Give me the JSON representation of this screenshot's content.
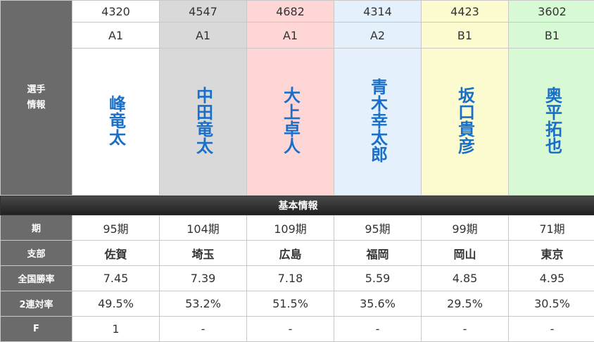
{
  "racers": [
    {
      "number": "4320",
      "class": "A1",
      "name": "峰竜太",
      "term": "95期",
      "branch": "佐賀",
      "win_rate": "7.45",
      "quinella_rate": "49.5%",
      "f": "1"
    },
    {
      "number": "4547",
      "class": "A1",
      "name": "中田竜太",
      "term": "104期",
      "branch": "埼玉",
      "win_rate": "7.39",
      "quinella_rate": "53.2%",
      "f": "-"
    },
    {
      "number": "4682",
      "class": "A1",
      "name": "大上卓人",
      "term": "109期",
      "branch": "広島",
      "win_rate": "7.18",
      "quinella_rate": "51.5%",
      "f": "-"
    },
    {
      "number": "4314",
      "class": "A2",
      "name": "青木幸太郎",
      "term": "95期",
      "branch": "福岡",
      "win_rate": "5.59",
      "quinella_rate": "35.6%",
      "f": "-"
    },
    {
      "number": "4423",
      "class": "B1",
      "name": "坂口貴彦",
      "term": "99期",
      "branch": "岡山",
      "win_rate": "4.85",
      "quinella_rate": "29.5%",
      "f": "-"
    },
    {
      "number": "3602",
      "class": "B1",
      "name": "奥平拓也",
      "term": "71期",
      "branch": "東京",
      "win_rate": "4.95",
      "quinella_rate": "30.5%",
      "f": "-"
    }
  ],
  "labels": {
    "racer_info_1": "選手",
    "racer_info_2": "情報",
    "section_basic": "基本情報",
    "term": "期",
    "branch": "支部",
    "win_rate": "全国勝率",
    "quinella_rate": "2連対率",
    "f": "F"
  },
  "colors": {
    "name_text": "#1a6fc9",
    "lane_bg": [
      "#ffffff",
      "#d9d9d9",
      "#ffd6d6",
      "#e4f0fc",
      "#fbfbcf",
      "#d7f9d3"
    ]
  }
}
